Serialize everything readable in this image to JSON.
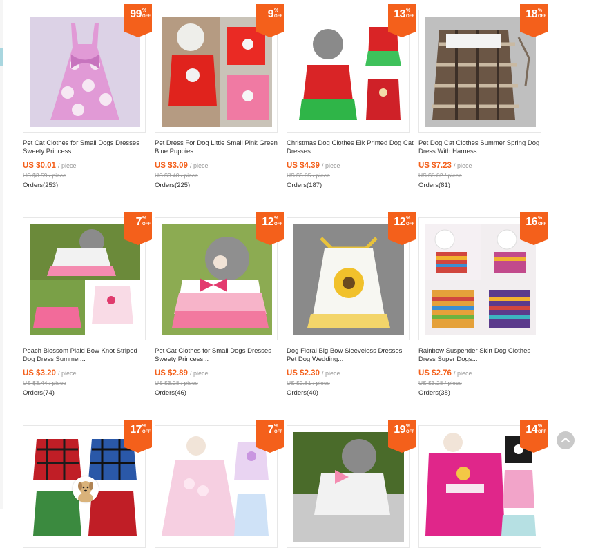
{
  "products": [
    {
      "discount": "99",
      "pct": "%",
      "off": "OFF",
      "title": "Pet Cat Clothes for Small Dogs Dresses Sweety Princess...",
      "price": "US $0.01",
      "unit": "/ piece",
      "old_price": "US $3.59 / piece",
      "orders": "Orders(253)"
    },
    {
      "discount": "9",
      "pct": "%",
      "off": "OFF",
      "title": "Pet Dress For Dog Little Small Pink Green Blue Puppies...",
      "price": "US $3.09",
      "unit": "/ piece",
      "old_price": "US $3.40 / piece",
      "orders": "Orders(225)"
    },
    {
      "discount": "13",
      "pct": "%",
      "off": "OFF",
      "title": "Christmas Dog Clothes Elk Printed Dog Cat Dresses...",
      "price": "US $4.39",
      "unit": "/ piece",
      "old_price": "US $5.05 / piece",
      "orders": "Orders(187)"
    },
    {
      "discount": "18",
      "pct": "%",
      "off": "OFF",
      "title": "Pet Dog Cat Clothes Summer Spring Dog Dress With Harness...",
      "price": "US $7.23",
      "unit": "/ piece",
      "old_price": "US $8.82 / piece",
      "orders": "Orders(81)"
    },
    {
      "discount": "7",
      "pct": "%",
      "off": "OFF",
      "title": "Peach Blossom Plaid Bow Knot Striped Dog Dress Summer...",
      "price": "US $3.20",
      "unit": "/ piece",
      "old_price": "US $3.44 / piece",
      "orders": "Orders(74)"
    },
    {
      "discount": "12",
      "pct": "%",
      "off": "OFF",
      "title": "Pet Cat Clothes for Small Dogs Dresses Sweety Princess...",
      "price": "US $2.89",
      "unit": "/ piece",
      "old_price": "US $3.28 / piece",
      "orders": "Orders(46)"
    },
    {
      "discount": "12",
      "pct": "%",
      "off": "OFF",
      "title": "Dog Floral Big Bow Sleeveless Dresses Pet Dog Wedding...",
      "price": "US $2.30",
      "unit": "/ piece",
      "old_price": "US $2.61 / piece",
      "orders": "Orders(40)"
    },
    {
      "discount": "16",
      "pct": "%",
      "off": "OFF",
      "title": "Rainbow Suspender Skirt Dog Clothes Dress Super Dogs...",
      "price": "US $2.76",
      "unit": "/ piece",
      "old_price": "US $3.28 / piece",
      "orders": "Orders(38)"
    },
    {
      "discount": "17",
      "pct": "%",
      "off": "OFF"
    },
    {
      "discount": "7",
      "pct": "%",
      "off": "OFF"
    },
    {
      "discount": "19",
      "pct": "%",
      "off": "OFF"
    },
    {
      "discount": "14",
      "pct": "%",
      "off": "OFF"
    }
  ],
  "colors": {
    "accent": "#f4601b",
    "text": "#333333",
    "muted": "#999999"
  },
  "icons": {
    "scroll_top": "chevron-up-icon",
    "avatar": "dog-avatar-icon"
  }
}
